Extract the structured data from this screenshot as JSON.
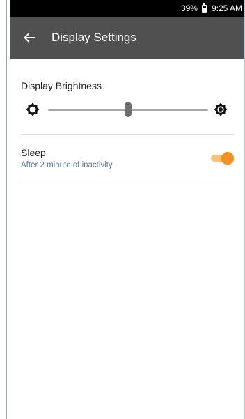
{
  "status_bar": {
    "battery_percent": "39%",
    "time": "9:25 AM",
    "icons": [
      "battery-icon"
    ]
  },
  "app_bar": {
    "title": "Display Settings",
    "back_icon": "arrow-left-icon"
  },
  "brightness": {
    "label": "Display Brightness",
    "level": 0.5,
    "low_icon": "brightness-low-icon",
    "high_icon": "brightness-high-icon"
  },
  "sleep": {
    "title": "Sleep",
    "subtitle": "After 2 minute of inactivity",
    "enabled": true
  },
  "colors": {
    "app_bar": "#505050",
    "status_bar": "#000000",
    "accent": "#f39223",
    "accent_track": "#f6c07d",
    "subtitle": "#5a7b95"
  }
}
